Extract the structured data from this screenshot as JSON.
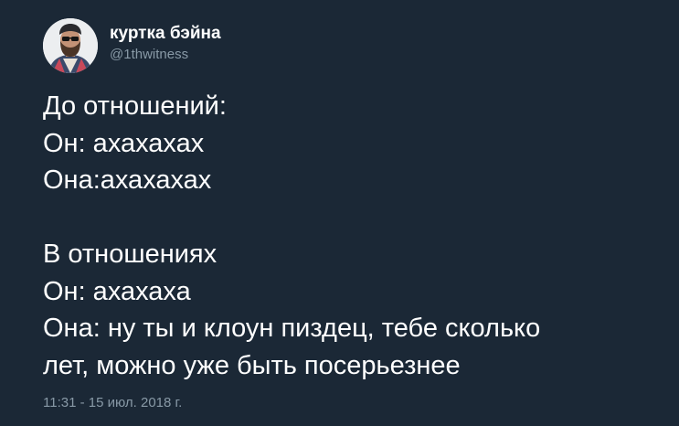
{
  "author": {
    "display_name": "куртка бэйна",
    "handle": "@1thwitness",
    "avatar_icon": "user-avatar-photo"
  },
  "tweet": {
    "lines": [
      "До отношений:",
      "Он: ахахахах",
      "Она:ахахахах",
      "",
      "В отношениях",
      "Он: ахахаха",
      "Она: ну ты и клоун пиздец, тебе сколько",
      "лет, можно уже быть посерьезнее"
    ],
    "timestamp": "11:31 - 15 июл. 2018 г."
  },
  "colors": {
    "background": "#1b2836",
    "text": "#ffffff",
    "secondary": "#8899a6"
  }
}
